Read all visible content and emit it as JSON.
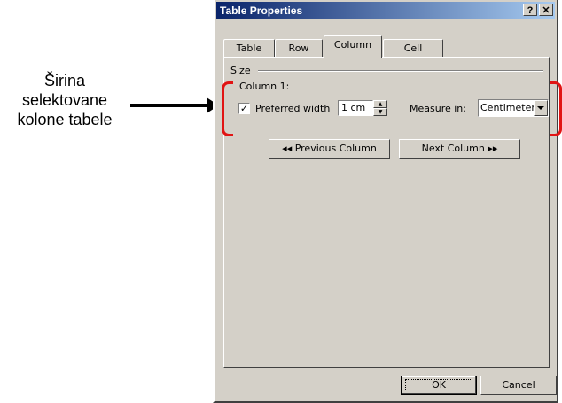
{
  "annotation": {
    "lines": [
      "Širina",
      "selektovane",
      "kolone tabele"
    ],
    "arrow_color": "#000000",
    "bracket_color": "#e11414"
  },
  "dialog": {
    "title": "Table Properties",
    "help_button": "?",
    "close_button": "✕",
    "tabs": [
      {
        "label": "Table",
        "active": false
      },
      {
        "label": "Row",
        "active": false
      },
      {
        "label": "Column",
        "active": true
      },
      {
        "label": "Cell",
        "active": false
      }
    ],
    "section_label": "Size",
    "column_label": "Column 1:",
    "preferred_width": {
      "checked": true,
      "check_glyph": "✓",
      "label": "Preferred width",
      "value": "1 cm"
    },
    "measure_in": {
      "label": "Measure in:",
      "value": "Centimeters"
    },
    "previous_button": "◂◂ Previous Column",
    "next_button": "Next Column ▸▸",
    "ok_button": "OK",
    "cancel_button": "Cancel"
  }
}
